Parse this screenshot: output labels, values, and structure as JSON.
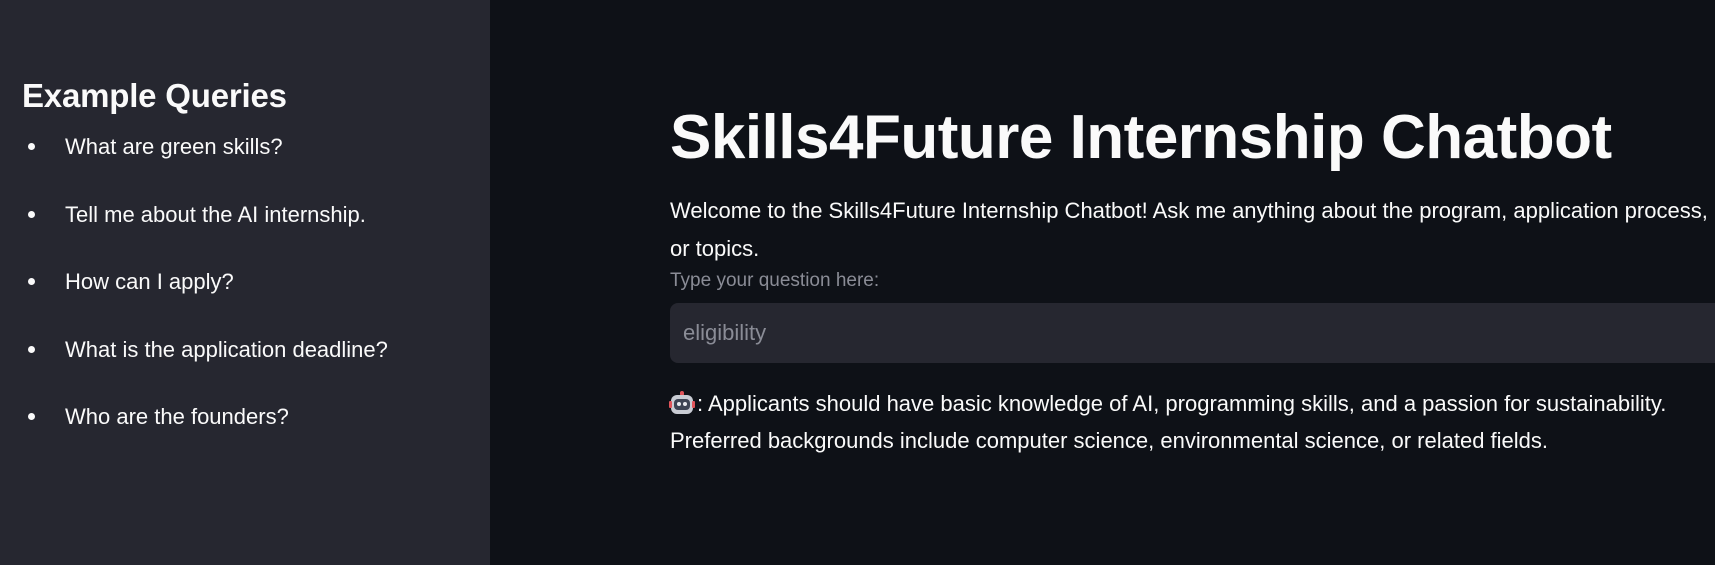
{
  "sidebar": {
    "title": "Example Queries",
    "queries": [
      "What are green skills?",
      "Tell me about the AI internship.",
      "How can I apply?",
      "What is the application deadline?",
      "Who are the founders?"
    ]
  },
  "main": {
    "title": "Skills4Future Internship Chatbot",
    "welcome": "Welcome to the Skills4Future Internship Chatbot! Ask me anything about the program, application process, or topics.",
    "input": {
      "label": "Type your question here:",
      "value": "eligibility"
    },
    "answer": {
      "icon": "robot-icon",
      "text": ": Applicants should have basic knowledge of AI, programming skills, and a passion for sustainability. Preferred backgrounds include computer science, environmental science, or related fields."
    }
  },
  "colors": {
    "background": "#0e1117",
    "sidebar": "#262730",
    "text": "#fafafa",
    "muted": "#8a8c96"
  }
}
